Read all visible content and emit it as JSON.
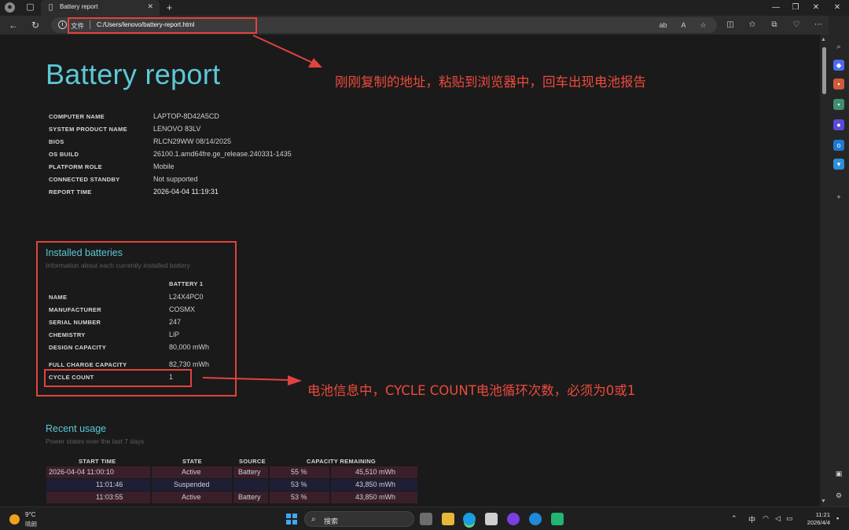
{
  "browser": {
    "tab_title": "Battery report",
    "address_scheme": "文件",
    "address_url": "C:/Users/lenovo/battery-report.html"
  },
  "report": {
    "title": "Battery report",
    "system_info": [
      {
        "key": "COMPUTER NAME",
        "value": "LAPTOP-8D42A5CD"
      },
      {
        "key": "SYSTEM PRODUCT NAME",
        "value": "LENOVO 83LV"
      },
      {
        "key": "BIOS",
        "value": "RLCN29WW 08/14/2025"
      },
      {
        "key": "OS BUILD",
        "value": "26100.1.amd64fre.ge_release.240331-1435"
      },
      {
        "key": "PLATFORM ROLE",
        "value": "Mobile"
      },
      {
        "key": "CONNECTED STANDBY",
        "value": "Not supported"
      },
      {
        "key": "REPORT TIME",
        "value": "2026-04-04  11:19:31"
      }
    ],
    "installed": {
      "title": "Installed batteries",
      "subtitle": "Information about each currently installed battery",
      "column_header": "BATTERY 1",
      "rows": [
        {
          "key": "NAME",
          "value": "L24X4PC0"
        },
        {
          "key": "MANUFACTURER",
          "value": "COSMX"
        },
        {
          "key": "SERIAL NUMBER",
          "value": "247"
        },
        {
          "key": "CHEMISTRY",
          "value": "LiP"
        },
        {
          "key": "DESIGN CAPACITY",
          "value": "80,000 mWh"
        },
        {
          "key": "FULL CHARGE CAPACITY",
          "value": "82,730 mWh"
        },
        {
          "key": "CYCLE COUNT",
          "value": "1"
        }
      ]
    },
    "usage": {
      "title": "Recent usage",
      "subtitle": "Power states over the last 7 days",
      "headers": [
        "START TIME",
        "STATE",
        "SOURCE",
        "CAPACITY REMAINING"
      ],
      "rows": [
        {
          "start": "2026-04-04  11:00:10",
          "state": "Active",
          "source": "Battery",
          "pct": "55 %",
          "mwh": "45,510 mWh"
        },
        {
          "start": "11:01:46",
          "state": "Suspended",
          "source": "",
          "pct": "53 %",
          "mwh": "43,850 mWh"
        },
        {
          "start": "11:03:55",
          "state": "Active",
          "source": "Battery",
          "pct": "53 %",
          "mwh": "43,850 mWh"
        }
      ]
    }
  },
  "annotations": {
    "address_note": "刚刚复制的地址，粘贴到浏览器中，回车出现电池报告",
    "cycle_note": "电池信息中，CYCLE COUNT电池循环次数，必须为0或1",
    "color": "#e0433e"
  },
  "taskbar": {
    "temperature": "9°C",
    "condition": "晴朗",
    "search_label": "搜索",
    "ime": "中",
    "time": "11:21",
    "date": "2026/4/4"
  }
}
